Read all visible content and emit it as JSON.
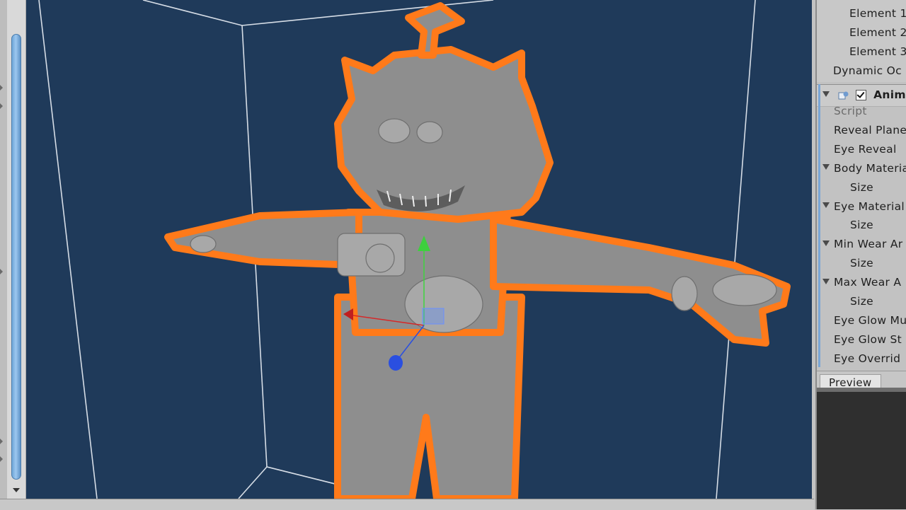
{
  "inspector": {
    "top_rows": [
      "Element 1",
      "Element 2",
      "Element 3",
      "Dynamic Oc"
    ],
    "component": {
      "title": "Anima",
      "fields": [
        {
          "label": "Script",
          "dim": true,
          "foldout": false,
          "indent": false
        },
        {
          "label": "Reveal Plane",
          "dim": false,
          "foldout": false,
          "indent": false
        },
        {
          "label": "Eye Reveal",
          "dim": false,
          "foldout": false,
          "indent": false
        },
        {
          "label": "Body Materia",
          "dim": false,
          "foldout": true,
          "indent": false
        },
        {
          "label": "Size",
          "dim": false,
          "foldout": false,
          "indent": true
        },
        {
          "label": "Eye Material",
          "dim": false,
          "foldout": true,
          "indent": false
        },
        {
          "label": "Size",
          "dim": false,
          "foldout": false,
          "indent": true
        },
        {
          "label": "Min Wear Ar",
          "dim": false,
          "foldout": true,
          "indent": false
        },
        {
          "label": "Size",
          "dim": false,
          "foldout": false,
          "indent": true
        },
        {
          "label": "Max Wear A",
          "dim": false,
          "foldout": true,
          "indent": false
        },
        {
          "label": "Size",
          "dim": false,
          "foldout": false,
          "indent": true
        },
        {
          "label": "Eye Glow Mu",
          "dim": false,
          "foldout": false,
          "indent": false
        },
        {
          "label": "Eye Glow St",
          "dim": false,
          "foldout": false,
          "indent": false
        },
        {
          "label": "Eye Overrid",
          "dim": false,
          "foldout": false,
          "indent": false
        }
      ]
    },
    "preview_label": "Preview"
  },
  "colors": {
    "viewport_bg": "#1f3a5a",
    "selection_outline": "#ff7a1a",
    "model_fill": "#8e8e8e",
    "gizmo_x": "#d62828",
    "gizmo_y": "#3fd43f",
    "gizmo_z": "#2a4fe0"
  }
}
